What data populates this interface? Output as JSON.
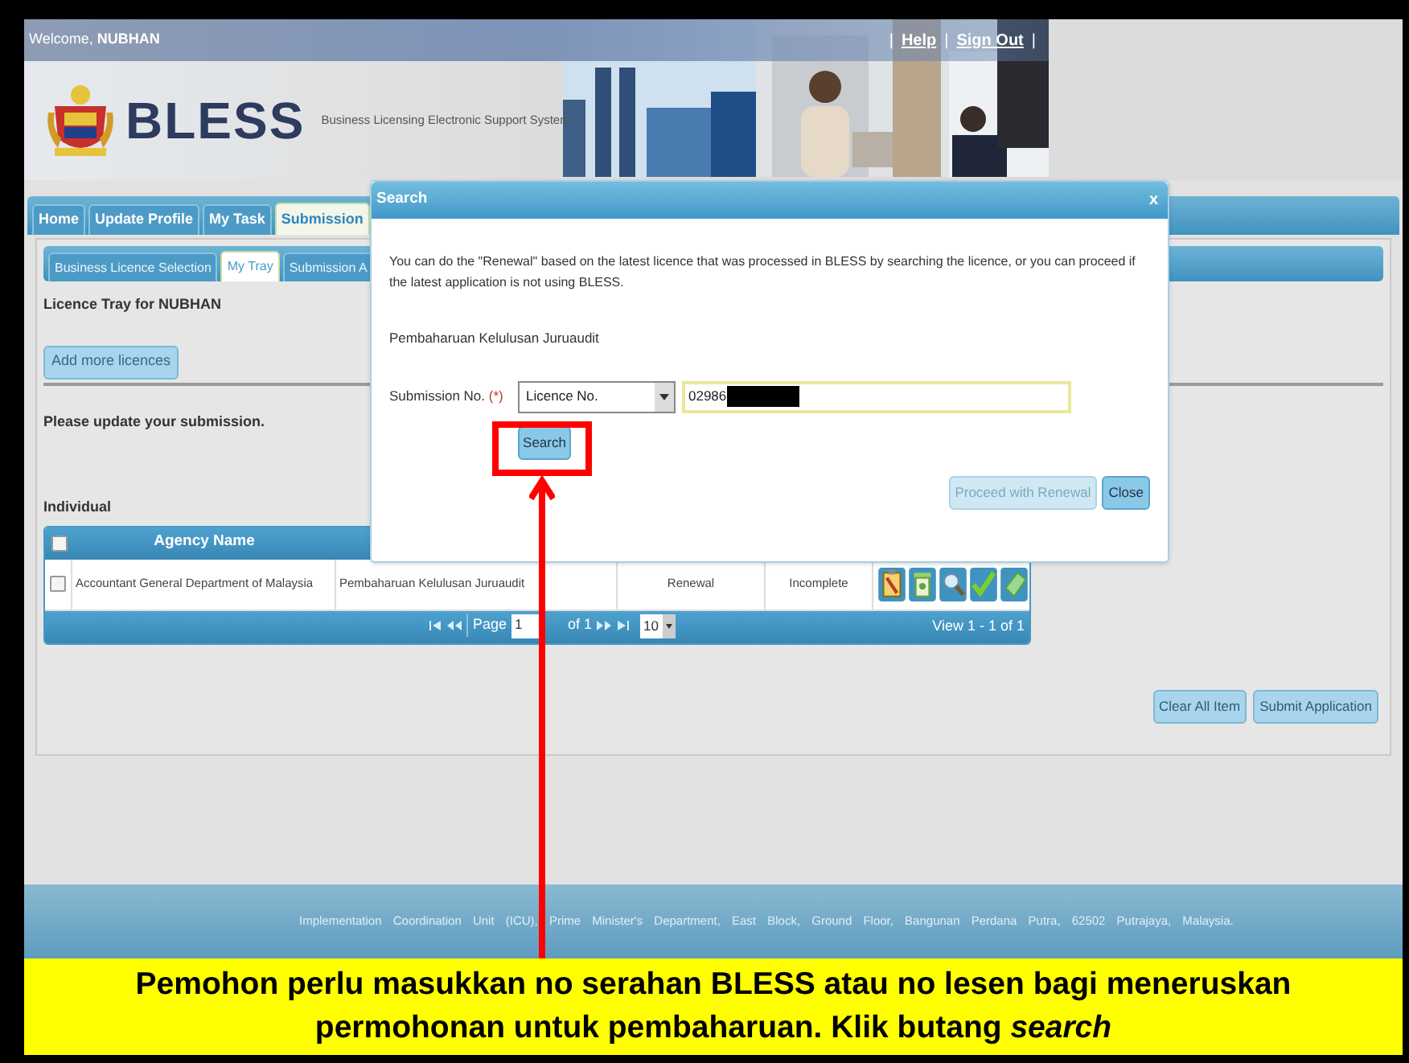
{
  "header": {
    "welcome_label": "Welcome,",
    "user": "NUBHAN",
    "links": [
      {
        "kind": "separator",
        "text": "|"
      },
      {
        "kind": "link",
        "text": "Help"
      },
      {
        "kind": "separator",
        "text": "|"
      },
      {
        "kind": "link",
        "text": "Sign Out"
      },
      {
        "kind": "separator",
        "text": "|"
      }
    ]
  },
  "brand": {
    "logo_text": "BLESS",
    "tagline": "Business Licensing Electronic Support System"
  },
  "nav_tabs": [
    {
      "label": "Home",
      "selected": false
    },
    {
      "label": "Update Profile",
      "selected": false
    },
    {
      "label": "My Task",
      "selected": false
    },
    {
      "label": "Submission",
      "selected": true
    }
  ],
  "sub_tabs": [
    {
      "label": "Business Licence Selection",
      "selected": false
    },
    {
      "label": "My Tray",
      "selected": true
    },
    {
      "label": "Submission A",
      "selected": false
    }
  ],
  "tray_title": "Licence Tray for NUBHAN",
  "add_button": "Add more licences",
  "notice": "Please update your submission.",
  "section_title": "Individual",
  "table": {
    "select_all_checked": false,
    "columns": [
      "Agency Name"
    ],
    "rows": [
      {
        "checked": false,
        "cells": [
          "Accountant General Department of Malaysia",
          "Pembaharuan Kelulusan Juruaudit",
          "Renewal",
          "Incomplete"
        ]
      }
    ],
    "pager": {
      "page_label": "Page",
      "page": "1",
      "of": "of 1",
      "page_size": "10",
      "summary": "View 1 - 1 of 1"
    }
  },
  "actions": [
    "Clear All Item",
    "Submit Application"
  ],
  "footer": "Implementation Coordination Unit (ICU), Prime Minister's Department, East Block, Ground Floor, Bangunan Perdana Putra, 62502 Putrajaya, Malaysia.",
  "dialog": {
    "title": "Search",
    "close": "x",
    "message": "You can do the \"Renewal\" based on the latest licence that was processed in BLESS by searching the licence, or you can proceed if the latest application is not using BLESS.",
    "licence_name": "Pembaharuan Kelulusan Juruaudit",
    "field_label": "Submission No.",
    "required_mark": "(*)",
    "select_value": "Licence No.",
    "input_value": "02986",
    "search_button": "Search",
    "buttons": [
      {
        "label": "Proceed with Renewal",
        "disabled": true
      },
      {
        "label": "Close",
        "disabled": false
      }
    ]
  },
  "caption": "Pemohon perlu masukkan no serahan BLESS atau no lesen bagi meneruskan permohonan untuk pembaharuan. Klik butang *search*"
}
